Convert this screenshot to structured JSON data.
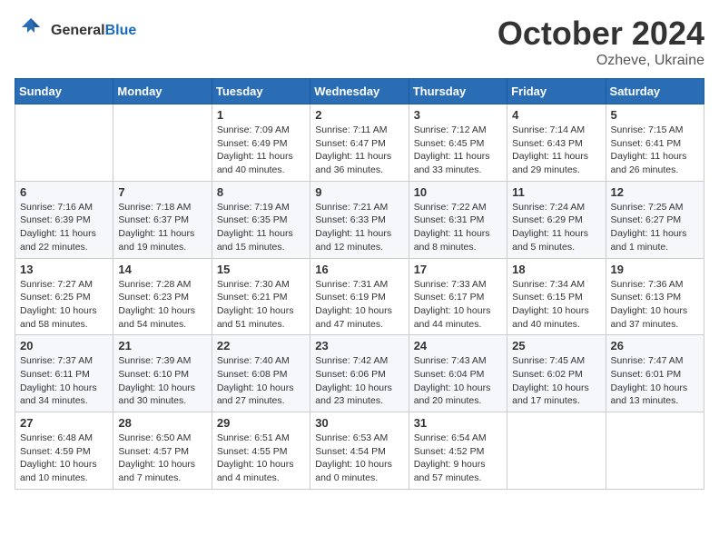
{
  "header": {
    "logo_general": "General",
    "logo_blue": "Blue",
    "month": "October 2024",
    "location": "Ozheve, Ukraine"
  },
  "weekdays": [
    "Sunday",
    "Monday",
    "Tuesday",
    "Wednesday",
    "Thursday",
    "Friday",
    "Saturday"
  ],
  "weeks": [
    [
      {
        "day": "",
        "content": ""
      },
      {
        "day": "",
        "content": ""
      },
      {
        "day": "1",
        "content": "Sunrise: 7:09 AM\nSunset: 6:49 PM\nDaylight: 11 hours and 40 minutes."
      },
      {
        "day": "2",
        "content": "Sunrise: 7:11 AM\nSunset: 6:47 PM\nDaylight: 11 hours and 36 minutes."
      },
      {
        "day": "3",
        "content": "Sunrise: 7:12 AM\nSunset: 6:45 PM\nDaylight: 11 hours and 33 minutes."
      },
      {
        "day": "4",
        "content": "Sunrise: 7:14 AM\nSunset: 6:43 PM\nDaylight: 11 hours and 29 minutes."
      },
      {
        "day": "5",
        "content": "Sunrise: 7:15 AM\nSunset: 6:41 PM\nDaylight: 11 hours and 26 minutes."
      }
    ],
    [
      {
        "day": "6",
        "content": "Sunrise: 7:16 AM\nSunset: 6:39 PM\nDaylight: 11 hours and 22 minutes."
      },
      {
        "day": "7",
        "content": "Sunrise: 7:18 AM\nSunset: 6:37 PM\nDaylight: 11 hours and 19 minutes."
      },
      {
        "day": "8",
        "content": "Sunrise: 7:19 AM\nSunset: 6:35 PM\nDaylight: 11 hours and 15 minutes."
      },
      {
        "day": "9",
        "content": "Sunrise: 7:21 AM\nSunset: 6:33 PM\nDaylight: 11 hours and 12 minutes."
      },
      {
        "day": "10",
        "content": "Sunrise: 7:22 AM\nSunset: 6:31 PM\nDaylight: 11 hours and 8 minutes."
      },
      {
        "day": "11",
        "content": "Sunrise: 7:24 AM\nSunset: 6:29 PM\nDaylight: 11 hours and 5 minutes."
      },
      {
        "day": "12",
        "content": "Sunrise: 7:25 AM\nSunset: 6:27 PM\nDaylight: 11 hours and 1 minute."
      }
    ],
    [
      {
        "day": "13",
        "content": "Sunrise: 7:27 AM\nSunset: 6:25 PM\nDaylight: 10 hours and 58 minutes."
      },
      {
        "day": "14",
        "content": "Sunrise: 7:28 AM\nSunset: 6:23 PM\nDaylight: 10 hours and 54 minutes."
      },
      {
        "day": "15",
        "content": "Sunrise: 7:30 AM\nSunset: 6:21 PM\nDaylight: 10 hours and 51 minutes."
      },
      {
        "day": "16",
        "content": "Sunrise: 7:31 AM\nSunset: 6:19 PM\nDaylight: 10 hours and 47 minutes."
      },
      {
        "day": "17",
        "content": "Sunrise: 7:33 AM\nSunset: 6:17 PM\nDaylight: 10 hours and 44 minutes."
      },
      {
        "day": "18",
        "content": "Sunrise: 7:34 AM\nSunset: 6:15 PM\nDaylight: 10 hours and 40 minutes."
      },
      {
        "day": "19",
        "content": "Sunrise: 7:36 AM\nSunset: 6:13 PM\nDaylight: 10 hours and 37 minutes."
      }
    ],
    [
      {
        "day": "20",
        "content": "Sunrise: 7:37 AM\nSunset: 6:11 PM\nDaylight: 10 hours and 34 minutes."
      },
      {
        "day": "21",
        "content": "Sunrise: 7:39 AM\nSunset: 6:10 PM\nDaylight: 10 hours and 30 minutes."
      },
      {
        "day": "22",
        "content": "Sunrise: 7:40 AM\nSunset: 6:08 PM\nDaylight: 10 hours and 27 minutes."
      },
      {
        "day": "23",
        "content": "Sunrise: 7:42 AM\nSunset: 6:06 PM\nDaylight: 10 hours and 23 minutes."
      },
      {
        "day": "24",
        "content": "Sunrise: 7:43 AM\nSunset: 6:04 PM\nDaylight: 10 hours and 20 minutes."
      },
      {
        "day": "25",
        "content": "Sunrise: 7:45 AM\nSunset: 6:02 PM\nDaylight: 10 hours and 17 minutes."
      },
      {
        "day": "26",
        "content": "Sunrise: 7:47 AM\nSunset: 6:01 PM\nDaylight: 10 hours and 13 minutes."
      }
    ],
    [
      {
        "day": "27",
        "content": "Sunrise: 6:48 AM\nSunset: 4:59 PM\nDaylight: 10 hours and 10 minutes."
      },
      {
        "day": "28",
        "content": "Sunrise: 6:50 AM\nSunset: 4:57 PM\nDaylight: 10 hours and 7 minutes."
      },
      {
        "day": "29",
        "content": "Sunrise: 6:51 AM\nSunset: 4:55 PM\nDaylight: 10 hours and 4 minutes."
      },
      {
        "day": "30",
        "content": "Sunrise: 6:53 AM\nSunset: 4:54 PM\nDaylight: 10 hours and 0 minutes."
      },
      {
        "day": "31",
        "content": "Sunrise: 6:54 AM\nSunset: 4:52 PM\nDaylight: 9 hours and 57 minutes."
      },
      {
        "day": "",
        "content": ""
      },
      {
        "day": "",
        "content": ""
      }
    ]
  ]
}
